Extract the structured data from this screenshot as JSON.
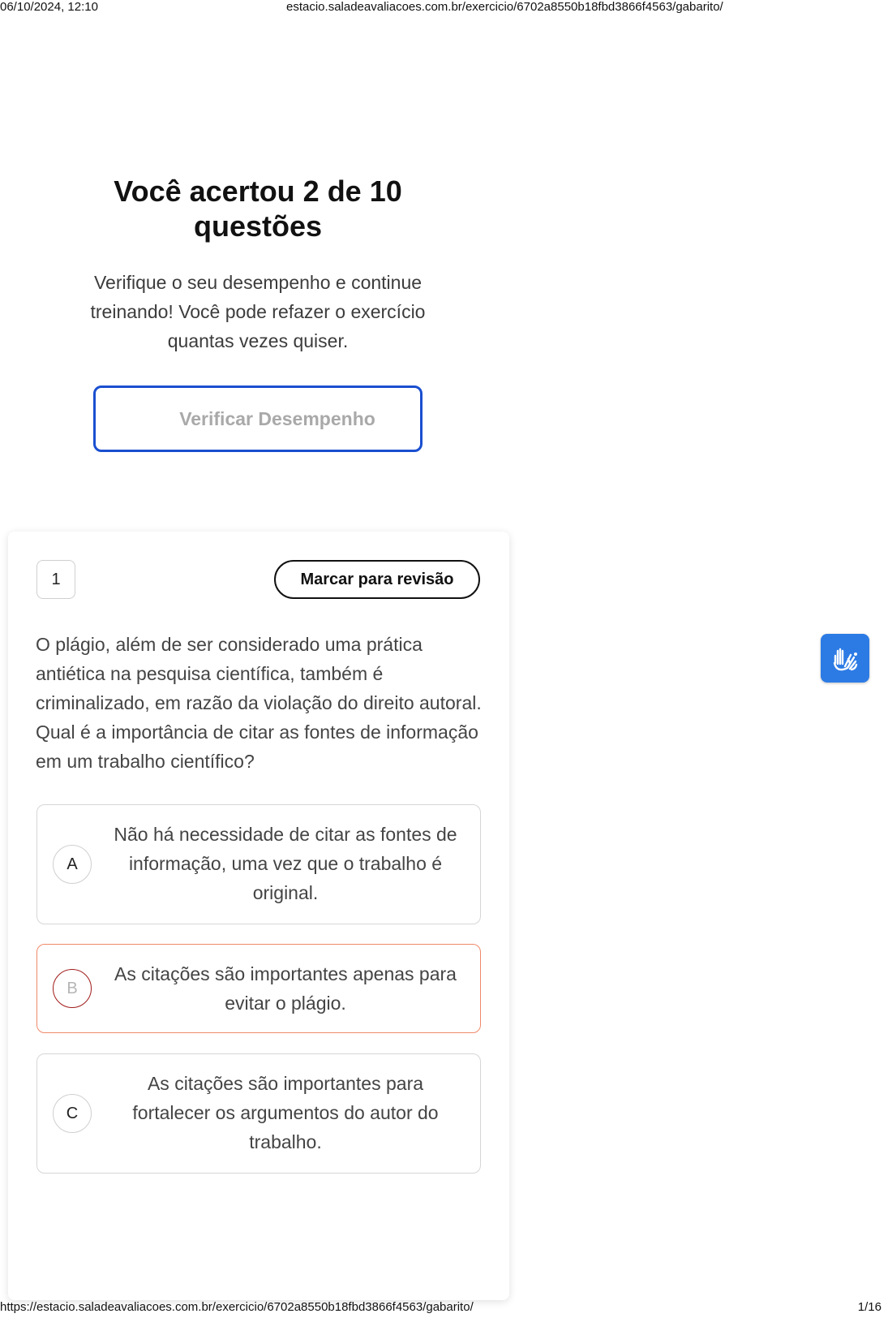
{
  "print_header": {
    "datetime": "06/10/2024, 12:10",
    "url": "estacio.saladeavaliacoes.com.br/exercicio/6702a8550b18fbd3866f4563/gabarito/"
  },
  "result": {
    "title": "Você acertou 2 de 10 questões",
    "subtitle": "Verifique o seu desempenho e continue treinando! Você pode refazer o exercício quantas vezes quiser.",
    "button_label": "Verificar Desempenho"
  },
  "question": {
    "number": "1",
    "review_label": "Marcar para revisão",
    "text": "O plágio, além de ser considerado uma prática antiética na pesquisa científica, também é criminalizado, em razão da violação do direito autoral. Qual é a importância de citar as fontes de informação em um trabalho científico?",
    "options": [
      {
        "letter": "A",
        "text": "Não há necessidade de citar as fontes de informação, uma vez que o trabalho é original."
      },
      {
        "letter": "B",
        "text": "As citações são importantes apenas para evitar o plágio.",
        "state": "selected-wrong"
      },
      {
        "letter": "C",
        "text": "As citações são importantes para fortalecer os argumentos do autor do trabalho."
      }
    ]
  },
  "accessibility": {
    "icon": "sign-language-hands-icon",
    "color": "#2c7be5"
  },
  "print_footer": {
    "url": "https://estacio.saladeavaliacoes.com.br/exercicio/6702a8550b18fbd3866f4563/gabarito/",
    "page": "1/16"
  },
  "colors": {
    "primary_border": "#1a4fd0",
    "wrong_border": "#f08a6a",
    "wrong_letter_border": "#a01a1a"
  }
}
